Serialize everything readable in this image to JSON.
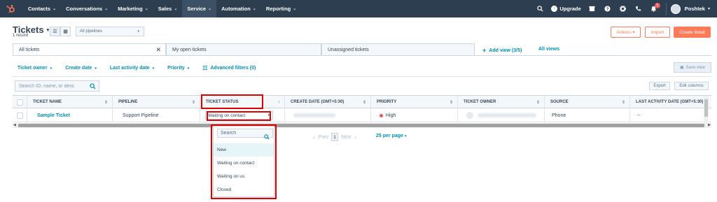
{
  "nav": {
    "items": [
      {
        "label": "Contacts",
        "chevron": "⌄"
      },
      {
        "label": "Conversations",
        "chevron": "⌄"
      },
      {
        "label": "Marketing",
        "chevron": "⌄"
      },
      {
        "label": "Sales",
        "chevron": "⌄"
      },
      {
        "label": "Service",
        "chevron": "⌄"
      },
      {
        "label": "Automation",
        "chevron": "⌄"
      },
      {
        "label": "Reporting",
        "chevron": "⌄"
      }
    ],
    "active_item": "Service",
    "upgrade_label": "Upgrade",
    "notifications_count": "5",
    "account_name": "Poshtek",
    "icons": [
      "search-icon",
      "upgrade-icon",
      "marketplace-icon",
      "help-icon",
      "settings-icon",
      "calling-icon",
      "notifications-icon"
    ]
  },
  "header": {
    "title": "Tickets",
    "record_count": "1 record",
    "pipeline_select": "All pipelines",
    "actions_label": "Actions ▾",
    "import_label": "Import",
    "create_label": "Create ticket"
  },
  "tabs": {
    "items": [
      {
        "label": "All tickets"
      },
      {
        "label": "My open tickets"
      },
      {
        "label": "Unassigned tickets"
      }
    ],
    "add_view_label": "Add view (3/5)",
    "all_views_label": "All views"
  },
  "filters": {
    "items": [
      "Ticket owner",
      "Create date",
      "Last activity date",
      "Priority"
    ],
    "advanced_label": "Advanced filters (0)",
    "save_view_label": "Save view"
  },
  "table": {
    "search_placeholder": "Search ID, name, or desc",
    "export_label": "Export",
    "edit_columns_label": "Edit columns",
    "columns": [
      "TICKET NAME",
      "PIPELINE",
      "TICKET STATUS",
      "CREATE DATE (GMT+5:30)",
      "PRIORITY",
      "TICKET OWNER",
      "SOURCE",
      "LAST ACTIVITY DATE (GMT+5:30)"
    ],
    "rows": [
      {
        "ticket_name": "Sample Ticket",
        "pipeline": "Support Pipeline",
        "ticket_status": "Waiting on contact",
        "priority": "High",
        "source": "Phone",
        "last_activity": "--"
      }
    ]
  },
  "pagination": {
    "prev_label": "Prev",
    "page": "1",
    "next_label": "Next",
    "per_page_label": "25 per page"
  },
  "status_dropdown": {
    "search_placeholder": "Search",
    "options": [
      "New",
      "Waiting on contact",
      "Waiting on us",
      "Closed"
    ],
    "highlighted": "New"
  },
  "colors": {
    "nav_bg": "#2d3e50",
    "accent": "#ff7a59",
    "link": "#0091ae",
    "priority_high": "#f2545b",
    "annotation": "#e00000"
  }
}
